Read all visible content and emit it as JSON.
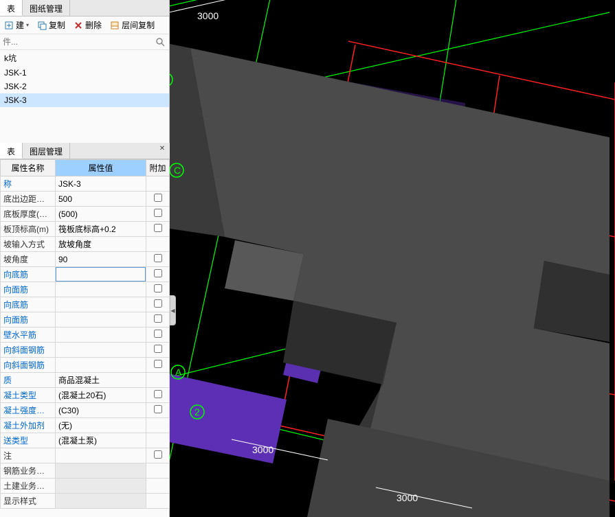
{
  "topPanel": {
    "tabs": [
      {
        "id": "list",
        "label": "表",
        "active": true
      },
      {
        "id": "drawings",
        "label": "图纸管理",
        "active": false
      }
    ],
    "toolbar": {
      "new": "建",
      "copy": "复制",
      "delete": "删除",
      "layerCopy": "层间复制"
    },
    "searchPlaceholder": "件...",
    "items": [
      {
        "label": "k坑",
        "selected": false
      },
      {
        "label": "JSK-1",
        "selected": false
      },
      {
        "label": "JSK-2",
        "selected": false
      },
      {
        "label": "JSK-3",
        "selected": true
      }
    ]
  },
  "propPanel": {
    "tabs": [
      {
        "id": "plist",
        "label": "表",
        "active": true
      },
      {
        "id": "layers",
        "label": "图层管理",
        "active": false
      }
    ],
    "headers": {
      "name": "属性名称",
      "value": "属性值",
      "extra": "附加"
    },
    "rows": [
      {
        "name": "称",
        "link": true,
        "value": "JSK-3",
        "chk": null
      },
      {
        "name": "底出边距离(...",
        "value": "500",
        "chk": false
      },
      {
        "name": "底板厚度(mm)",
        "value": "(500)",
        "chk": false
      },
      {
        "name": "板顶标高(m)",
        "value": "筏板底标高+0.2",
        "chk": false
      },
      {
        "name": "坡输入方式",
        "value": "放坡角度",
        "chk": null
      },
      {
        "name": "坡角度",
        "value": "90",
        "chk": false
      },
      {
        "name": "向底筋",
        "link": true,
        "value": "",
        "editing": true,
        "chk": false
      },
      {
        "name": "向面筋",
        "link": true,
        "value": "",
        "chk": false
      },
      {
        "name": "向底筋",
        "link": true,
        "value": "",
        "chk": false
      },
      {
        "name": "向面筋",
        "link": true,
        "value": "",
        "chk": false
      },
      {
        "name": "壁水平筋",
        "link": true,
        "value": "",
        "chk": false
      },
      {
        "name": "向斜面钢筋",
        "link": true,
        "value": "",
        "chk": false
      },
      {
        "name": "向斜面钢筋",
        "link": true,
        "value": "",
        "chk": false
      },
      {
        "name": "质",
        "link": true,
        "value": "商品混凝土",
        "chk": null
      },
      {
        "name": "凝土类型",
        "link": true,
        "value": "(混凝土20石)",
        "chk": false
      },
      {
        "name": "凝土强度等级",
        "link": true,
        "value": "(C30)",
        "chk": false
      },
      {
        "name": "凝土外加剂",
        "link": true,
        "value": "(无)",
        "chk": null
      },
      {
        "name": "送类型",
        "link": true,
        "value": "(混凝土泵)",
        "chk": null
      },
      {
        "name": "注",
        "value": "",
        "chk": false
      },
      {
        "name": "钢筋业务属性",
        "value": "",
        "disabled": true,
        "chk": null
      },
      {
        "name": "土建业务属性",
        "value": "",
        "disabled": true,
        "chk": null
      },
      {
        "name": "显示样式",
        "value": "",
        "disabled": true,
        "chk": null
      }
    ]
  },
  "viewport": {
    "dims": {
      "top": "3000",
      "bottomLeft": "3000",
      "bottomRight": "3000"
    },
    "axisLabels": [
      "D",
      "C",
      "A",
      "2"
    ]
  }
}
